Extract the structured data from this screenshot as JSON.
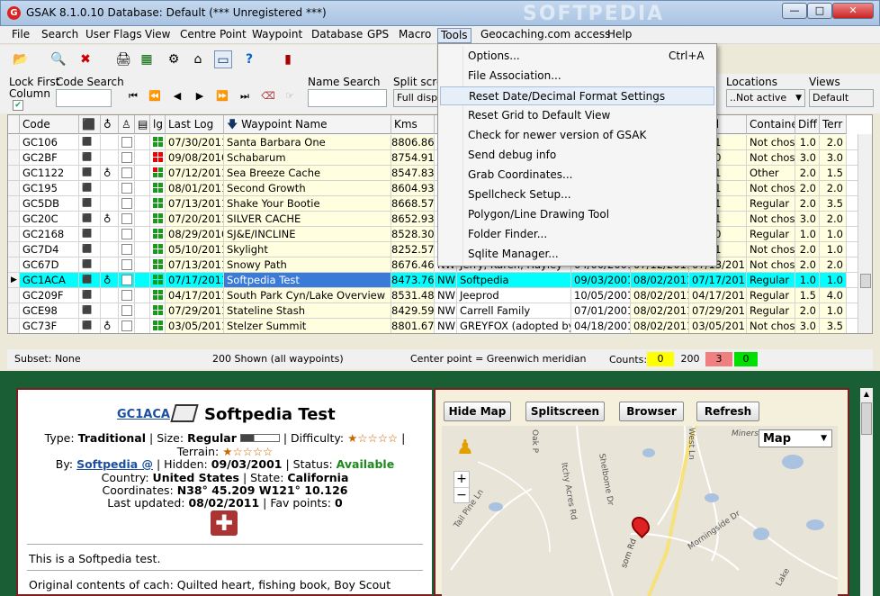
{
  "window": {
    "title": "GSAK 8.1.0.10    Database: Default    (*** Unregistered ***)",
    "watermark": "SOFTPEDIA",
    "min": "—",
    "max": "□",
    "close": "✕"
  },
  "menu": [
    "File",
    "Search",
    "User Flags",
    "View",
    "Centre Point",
    "Waypoint",
    "Database",
    "GPS",
    "Macro",
    "Tools",
    "Geocaching.com access",
    "Help"
  ],
  "tools_menu": [
    {
      "label": "Options...",
      "shortcut": "Ctrl+A"
    },
    {
      "label": "File Association...",
      "shortcut": ""
    },
    {
      "label": "Reset Date/Decimal Format Settings",
      "shortcut": ""
    },
    {
      "label": "Reset Grid to Default View",
      "shortcut": ""
    },
    {
      "label": "Check for newer version of GSAK",
      "shortcut": ""
    },
    {
      "label": "Send debug info",
      "shortcut": ""
    },
    {
      "label": "Grab Coordinates...",
      "shortcut": ""
    },
    {
      "label": "Spellcheck Setup...",
      "shortcut": ""
    },
    {
      "label": "Polygon/Line Drawing Tool",
      "shortcut": ""
    },
    {
      "label": "Folder Finder...",
      "shortcut": ""
    },
    {
      "label": "Sqlite Manager...",
      "shortcut": ""
    }
  ],
  "controls": {
    "lock_first": "Lock First",
    "column": "Column",
    "code_search": "Code Search",
    "name_search": "Name Search",
    "split_screen": "Split scree",
    "split_value": "Full displa",
    "locations": "Locations",
    "locations_value": "..Not active",
    "views": "Views",
    "views_value": "Default"
  },
  "grid": {
    "headers": {
      "code": "Code",
      "lg": "lg",
      "last_log": "Last Log",
      "name": "Waypoint Name",
      "kms": "Kms",
      "found": "ound",
      "container": "Container",
      "diff": "Diff",
      "terr": "Terr"
    },
    "rows": [
      {
        "code": "GC106",
        "tb": false,
        "log": "07/30/2011",
        "name": "Santa Barbara One",
        "kms": "8806.86",
        "dir": "",
        "owner": "",
        "hidden": "",
        "lastfound": "",
        "found": "'2011",
        "container": "Not chose",
        "diff": "1.0",
        "terr": "2.0",
        "lg": "gggg"
      },
      {
        "code": "GC2BF",
        "tb": false,
        "log": "09/08/2010",
        "name": "Schabarum",
        "kms": "8754.91",
        "dir": "",
        "owner": "",
        "hidden": "",
        "lastfound": "",
        "found": "'2010",
        "container": "Not chose",
        "diff": "3.0",
        "terr": "3.0",
        "lg": "rrrr"
      },
      {
        "code": "GC1122",
        "tb": true,
        "log": "07/12/2011",
        "name": "Sea Breeze Cache",
        "kms": "8547.83",
        "dir": "",
        "owner": "",
        "hidden": "",
        "lastfound": "",
        "found": "'2011",
        "container": "Other",
        "diff": "2.0",
        "terr": "1.5",
        "lg": "rggg"
      },
      {
        "code": "GC195",
        "tb": false,
        "log": "08/01/2011",
        "name": "Second Growth",
        "kms": "8604.93",
        "dir": "",
        "owner": "",
        "hidden": "",
        "lastfound": "",
        "found": "'2011",
        "container": "Not chose",
        "diff": "2.0",
        "terr": "2.0",
        "lg": "gggg"
      },
      {
        "code": "GC5DB",
        "tb": false,
        "log": "07/13/2011",
        "name": "Shake Your Bootie",
        "kms": "8668.57",
        "dir": "",
        "owner": "",
        "hidden": "",
        "lastfound": "",
        "found": "'2011",
        "container": "Regular",
        "diff": "2.0",
        "terr": "3.5",
        "lg": "gggg"
      },
      {
        "code": "GC20C",
        "tb": true,
        "log": "07/20/2011",
        "name": "SILVER CACHE",
        "kms": "8652.93",
        "dir": "",
        "owner": "",
        "hidden": "",
        "lastfound": "",
        "found": "'2011",
        "container": "Not chose",
        "diff": "3.0",
        "terr": "2.0",
        "lg": "gggg"
      },
      {
        "code": "GC2168",
        "tb": false,
        "log": "08/29/2010",
        "name": "SJ&E/INCLINE",
        "kms": "8528.30",
        "dir": "",
        "owner": "",
        "hidden": "",
        "lastfound": "",
        "found": "'2010",
        "container": "Regular",
        "diff": "1.0",
        "terr": "1.0",
        "lg": "gggg"
      },
      {
        "code": "GC7D4",
        "tb": false,
        "log": "05/10/2011",
        "name": "Skylight",
        "kms": "8252.57",
        "dir": "",
        "owner": "",
        "hidden": "",
        "lastfound": "",
        "found": "'2011",
        "container": "Not chose",
        "diff": "2.0",
        "terr": "1.0",
        "lg": "gggg"
      },
      {
        "code": "GC67D",
        "tb": false,
        "log": "07/13/2011",
        "name": "Snowy Path",
        "kms": "8676.46",
        "dir": "NW",
        "owner": "Jerry, Karen, Hayley",
        "hidden": "04/00/2001",
        "lastfound": "07/12/2011",
        "found": "07/13/2011",
        "container": "Not chose",
        "diff": "2.0",
        "terr": "2.0",
        "lg": "gggg"
      },
      {
        "code": "GC1ACA",
        "tb": true,
        "log": "07/17/2011",
        "name": "Softpedia Test",
        "kms": "8473.76",
        "dir": "NW",
        "owner": "Softpedia",
        "hidden": "09/03/2001",
        "lastfound": "08/02/2011",
        "found": "07/17/2011",
        "container": "Regular",
        "diff": "1.0",
        "terr": "1.0",
        "lg": "gggg",
        "selected": true
      },
      {
        "code": "GC209F",
        "tb": false,
        "log": "04/17/2011",
        "name": "South Park Cyn/Lake Overview",
        "kms": "8531.48",
        "dir": "NW",
        "owner": "Jeeprod",
        "hidden": "10/05/2001",
        "lastfound": "08/02/2011",
        "found": "04/17/2011",
        "container": "Regular",
        "diff": "1.5",
        "terr": "4.0",
        "lg": "gggg"
      },
      {
        "code": "GCE98",
        "tb": false,
        "log": "07/29/2011",
        "name": "Stateline Stash",
        "kms": "8429.59",
        "dir": "NW",
        "owner": "Carrell Family",
        "hidden": "07/01/2001",
        "lastfound": "08/02/2011",
        "found": "07/29/2011",
        "container": "Regular",
        "diff": "2.0",
        "terr": "1.0",
        "lg": "gggg"
      },
      {
        "code": "GC73F",
        "tb": true,
        "log": "03/05/2011",
        "name": "Stelzer Summit",
        "kms": "8801.67",
        "dir": "NW",
        "owner": "GREYFOX (adopted by N",
        "hidden": "04/18/2001",
        "lastfound": "08/02/2011",
        "found": "03/05/2011",
        "container": "Not chose",
        "diff": "3.0",
        "terr": "3.5",
        "lg": "gggg"
      }
    ]
  },
  "status": {
    "subset": "Subset: None",
    "shown": "200 Shown (all waypoints)",
    "center": "Center point = Greenwich meridian",
    "counts_label": "Counts:",
    "c1": "0",
    "c2": "200",
    "c3": "3",
    "c4": "0"
  },
  "detail": {
    "code": "GC1ACA",
    "title": "Softpedia Test",
    "type_label": "Type:",
    "type": "Traditional",
    "size_label": "| Size:",
    "size": "Regular",
    "diff_label": "| Difficulty:",
    "terr_label": "Terrain:",
    "by_label": "By:",
    "owner": "Softpedia @",
    "hidden_label": "| Hidden:",
    "hidden": "09/03/2001",
    "status_label": "| Status:",
    "status": "Available",
    "country_label": "Country:",
    "country": "United States",
    "state_label": "| State:",
    "state": "California",
    "coords_label": "Coordinates:",
    "coords": "N38° 45.209 W121° 10.126",
    "updated_label": "Last updated:",
    "updated": "08/02/2011",
    "fav_label": "| Fav points:",
    "fav": "0",
    "desc": "This is a Softpedia test.",
    "contents": "Original contents of cach: Quilted heart, fishing book, Boy Scout"
  },
  "map": {
    "hide": "Hide Map",
    "split": "Splitscreen",
    "browser": "Browser",
    "refresh": "Refresh",
    "type": "Map",
    "zoom_in": "+",
    "zoom_out": "−",
    "streets": [
      "Oak P",
      "West Ln",
      "Miners",
      "Tail Pine Ln",
      "Shelbome Dr",
      "Itchy Acres Rd",
      "Morningside Dr",
      "Lake",
      "som Rd"
    ]
  }
}
